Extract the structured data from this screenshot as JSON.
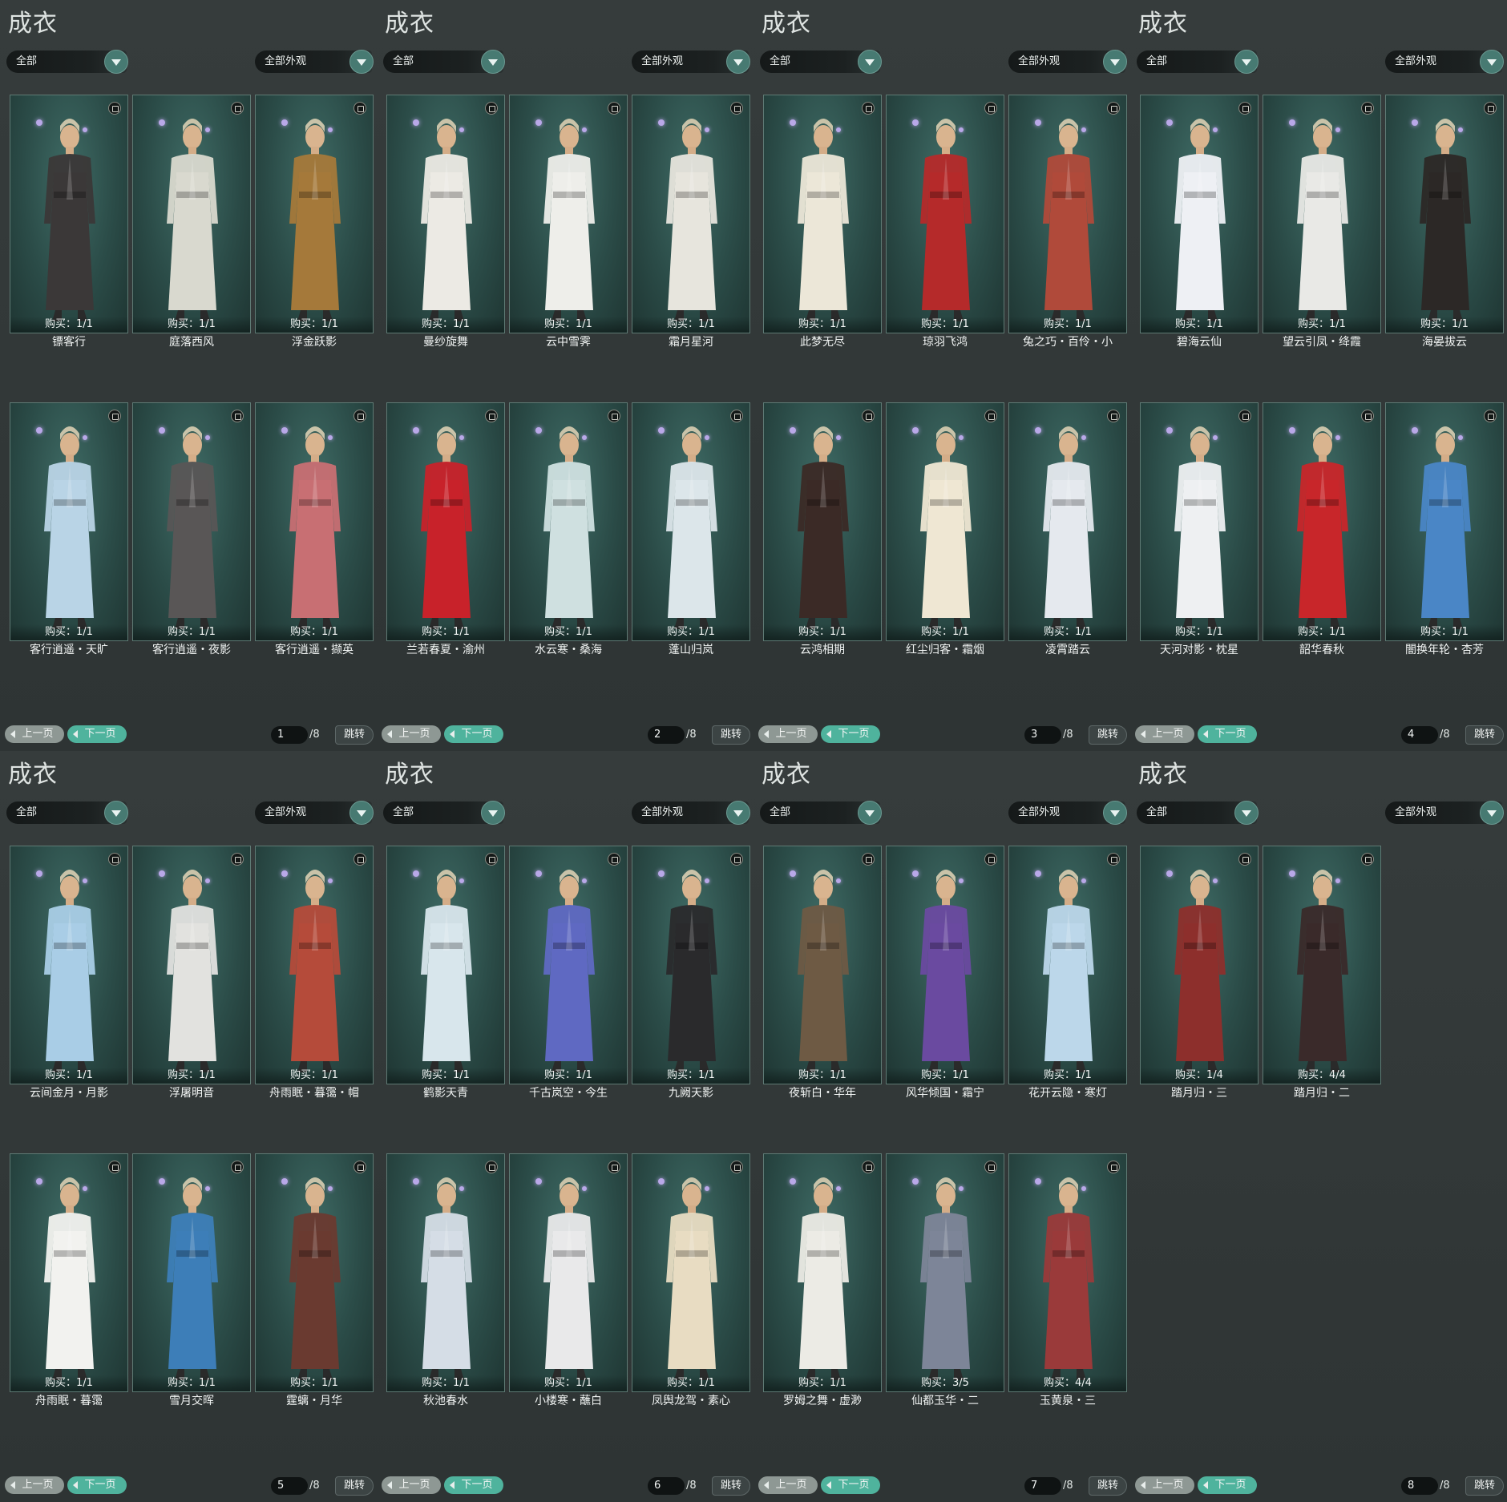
{
  "panels": [
    {
      "title": "成衣",
      "filter_left": "全部",
      "filter_right": "全部外观",
      "items": [
        {
          "buy": "购买：1/1",
          "name": "镖客行",
          "color": "#3b3838"
        },
        {
          "buy": "购买：1/1",
          "name": "庭落西风",
          "color": "#d9d9cf"
        },
        {
          "buy": "购买：1/1",
          "name": "浮金跃影",
          "color": "#a5793a"
        },
        {
          "buy": "购买：1/1",
          "name": "客行逍遥・天旷",
          "color": "#b9d4e6"
        },
        {
          "buy": "购买：1/1",
          "name": "客行逍遥・夜影",
          "color": "#595656"
        },
        {
          "buy": "购买：1/1",
          "name": "客行逍遥・撷英",
          "color": "#c86f73"
        }
      ],
      "page_current": "1",
      "page_total": "/8",
      "prev_label": "上一页",
      "next_label": "下一页",
      "jump_label": "跳转"
    },
    {
      "title": "成衣",
      "filter_left": "全部",
      "filter_right": "全部外观",
      "items": [
        {
          "buy": "购买：1/1",
          "name": "曼纱旋舞",
          "color": "#eceae4"
        },
        {
          "buy": "购买：1/1",
          "name": "云中雪霁",
          "color": "#eeeeea"
        },
        {
          "buy": "购买：1/1",
          "name": "霜月星河",
          "color": "#e7e5dd"
        },
        {
          "buy": "购买：1/1",
          "name": "兰若春夏・渝州",
          "color": "#c8222a"
        },
        {
          "buy": "购买：1/1",
          "name": "水云寒・桑海",
          "color": "#cfe0e0"
        },
        {
          "buy": "购买：1/1",
          "name": "蓬山归岚",
          "color": "#dce6ea"
        }
      ],
      "page_current": "2",
      "page_total": "/8",
      "prev_label": "上一页",
      "next_label": "下一页",
      "jump_label": "跳转"
    },
    {
      "title": "成衣",
      "filter_left": "全部",
      "filter_right": "全部外观",
      "items": [
        {
          "buy": "购买：1/1",
          "name": "此梦无尽",
          "color": "#ece7d8"
        },
        {
          "buy": "购买：1/1",
          "name": "琼羽飞鸿",
          "color": "#b52a2a"
        },
        {
          "buy": "购买：1/1",
          "name": "兔之巧・百伶・小",
          "color": "#b04a3a"
        },
        {
          "buy": "购买：1/1",
          "name": "云鸿相期",
          "color": "#3b2a26"
        },
        {
          "buy": "购买：1/1",
          "name": "红尘归客・霜烟",
          "color": "#efe7d3"
        },
        {
          "buy": "购买：1/1",
          "name": "凌霄踏云",
          "color": "#e5e9ee"
        }
      ],
      "page_current": "3",
      "page_total": "/8",
      "prev_label": "上一页",
      "next_label": "下一页",
      "jump_label": "跳转"
    },
    {
      "title": "成衣",
      "filter_left": "全部",
      "filter_right": "全部外观",
      "items": [
        {
          "buy": "购买：1/1",
          "name": "碧海云仙",
          "color": "#eef0f4"
        },
        {
          "buy": "购买：1/1",
          "name": "望云引凤・绛霞",
          "color": "#e9e9e6"
        },
        {
          "buy": "购买：1/1",
          "name": "海晏拔云",
          "color": "#2c2826"
        },
        {
          "buy": "购买：1/1",
          "name": "天河对影・枕星",
          "color": "#eef0f2"
        },
        {
          "buy": "购买：1/1",
          "name": "韶华春秋",
          "color": "#c8262a"
        },
        {
          "buy": "购买：1/1",
          "name": "闇换年轮・杏芳",
          "color": "#4a86c6"
        }
      ],
      "page_current": "4",
      "page_total": "/8",
      "prev_label": "上一页",
      "next_label": "下一页",
      "jump_label": "跳转"
    },
    {
      "title": "成衣",
      "filter_left": "全部",
      "filter_right": "全部外观",
      "items": [
        {
          "buy": "购买：1/1",
          "name": "云间金月・月影",
          "color": "#a9cde6"
        },
        {
          "buy": "购买：1/1",
          "name": "浮屠明音",
          "color": "#e2e2df"
        },
        {
          "buy": "购买：1/1",
          "name": "舟雨眠・暮霭・帽",
          "color": "#b54b3a"
        },
        {
          "buy": "购买：1/1",
          "name": "舟雨眠・暮霭",
          "color": "#f2f2ef"
        },
        {
          "buy": "购买：1/1",
          "name": "雪月交晖",
          "color": "#3d7eb8"
        },
        {
          "buy": "购买：1/1",
          "name": "霆螭・月华",
          "color": "#6a3a30"
        }
      ],
      "page_current": "5",
      "page_total": "/8",
      "prev_label": "上一页",
      "next_label": "下一页",
      "jump_label": "跳转"
    },
    {
      "title": "成衣",
      "filter_left": "全部",
      "filter_right": "全部外观",
      "items": [
        {
          "buy": "购买：1/1",
          "name": "鹤影天青",
          "color": "#d8e6ec"
        },
        {
          "buy": "购买：1/1",
          "name": "千古岚空・今生",
          "color": "#5f69c2"
        },
        {
          "buy": "购买：1/1",
          "name": "九阙天影",
          "color": "#2a2a2c"
        },
        {
          "buy": "购买：1/1",
          "name": "秋池春水",
          "color": "#d5dde6"
        },
        {
          "buy": "购买：1/1",
          "name": "小楼寒・蘸白",
          "color": "#e9e9ea"
        },
        {
          "buy": "购买：1/1",
          "name": "凤舆龙驾・素心",
          "color": "#e8dcc2"
        }
      ],
      "page_current": "6",
      "page_total": "/8",
      "prev_label": "上一页",
      "next_label": "下一页",
      "jump_label": "跳转"
    },
    {
      "title": "成衣",
      "filter_left": "全部",
      "filter_right": "全部外观",
      "items": [
        {
          "buy": "购买：1/1",
          "name": "夜斩白・华年",
          "color": "#6e5a44"
        },
        {
          "buy": "购买：1/1",
          "name": "风华倾国・霜宁",
          "color": "#6a4aa0"
        },
        {
          "buy": "购买：1/1",
          "name": "花开云隐・寒灯",
          "color": "#bcd7ea"
        },
        {
          "buy": "购买：1/1",
          "name": "罗姆之舞・虚渺",
          "color": "#ecebe5"
        },
        {
          "buy": "购买：3/5",
          "name": "仙都玉华・二",
          "color": "#7d8598"
        },
        {
          "buy": "购买：4/4",
          "name": "玉黄泉・三",
          "color": "#9a3a3a"
        }
      ],
      "page_current": "7",
      "page_total": "/8",
      "prev_label": "上一页",
      "next_label": "下一页",
      "jump_label": "跳转"
    },
    {
      "title": "成衣",
      "filter_left": "全部",
      "filter_right": "全部外观",
      "items": [
        {
          "buy": "购买：1/4",
          "name": "踏月归・三",
          "color": "#8d2f2c"
        },
        {
          "buy": "购买：4/4",
          "name": "踏月归・二",
          "color": "#3a2a2a"
        }
      ],
      "page_current": "8",
      "page_total": "/8",
      "prev_label": "上一页",
      "next_label": "下一页",
      "jump_label": "跳转"
    }
  ]
}
